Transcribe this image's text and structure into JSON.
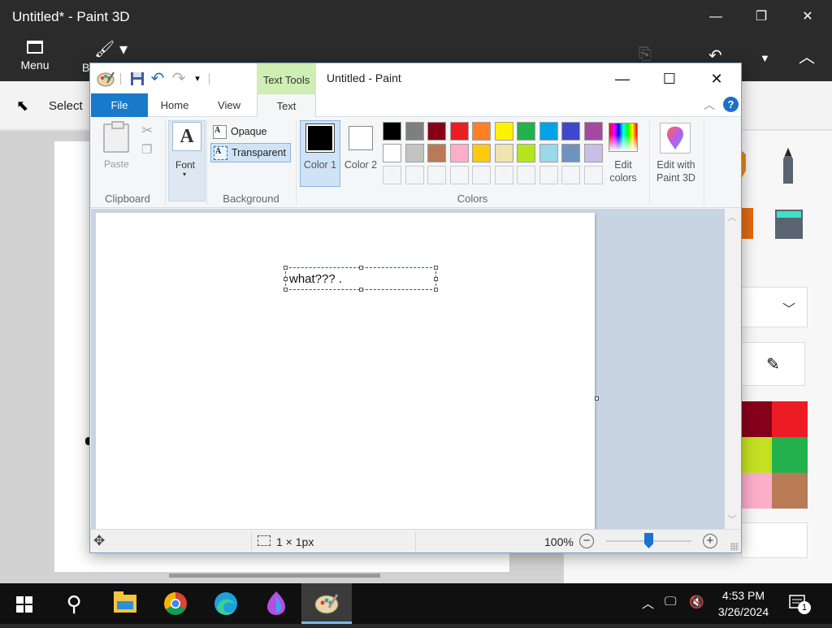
{
  "paint3d": {
    "title": "Untitled* - Paint 3D",
    "menu_label": "Menu",
    "brushes_label_partial": "B",
    "select_label": "Select",
    "palette_colors": [
      "#87001b",
      "#ed1c24",
      "#c4e022",
      "#22b14c",
      "#fcaec9",
      "#b97a56"
    ]
  },
  "paint": {
    "context_tab": "Text Tools",
    "title": "Untitled - Paint",
    "tabs": {
      "file": "File",
      "home": "Home",
      "view": "View",
      "text": "Text"
    },
    "help_label": "?",
    "clipboard": {
      "paste": "Paste",
      "group": "Clipboard"
    },
    "font": {
      "icon_letter": "A",
      "label": "Font",
      "caret": "▾"
    },
    "background": {
      "opaque": "Opaque",
      "transparent": "Transparent",
      "group": "Background",
      "active": "transparent"
    },
    "colors": {
      "color1_label": "Color 1",
      "color2_label": "Color 2",
      "color1_value": "#000000",
      "color2_value": "#ffffff",
      "edit_colors_label": "Edit colors",
      "edit_paint3d_label": "Edit with Paint 3D",
      "group": "Colors",
      "palette_row1": [
        "#000000",
        "#7f7f7f",
        "#880015",
        "#ed1c24",
        "#ff7f27",
        "#fff200",
        "#22b14c",
        "#00a2e8",
        "#3f48cc",
        "#a349a4"
      ],
      "palette_row2": [
        "#ffffff",
        "#c3c3c3",
        "#b97a57",
        "#ffaec9",
        "#ffc90e",
        "#efe4b0",
        "#b5e61d",
        "#99d9ea",
        "#7092be",
        "#c8bfe7"
      ],
      "palette_row3": [
        "#f3f5f7",
        "#f3f5f7",
        "#f3f5f7",
        "#f3f5f7",
        "#f3f5f7",
        "#f3f5f7",
        "#f3f5f7",
        "#f3f5f7",
        "#f3f5f7",
        "#f3f5f7"
      ]
    },
    "canvas_text": "what??? .",
    "status": {
      "selection_size": "1 × 1px",
      "zoom": "100%",
      "zoom_percent": 100
    }
  },
  "taskbar": {
    "time": "4:53 PM",
    "date": "3/26/2024",
    "notification_count": "1"
  }
}
